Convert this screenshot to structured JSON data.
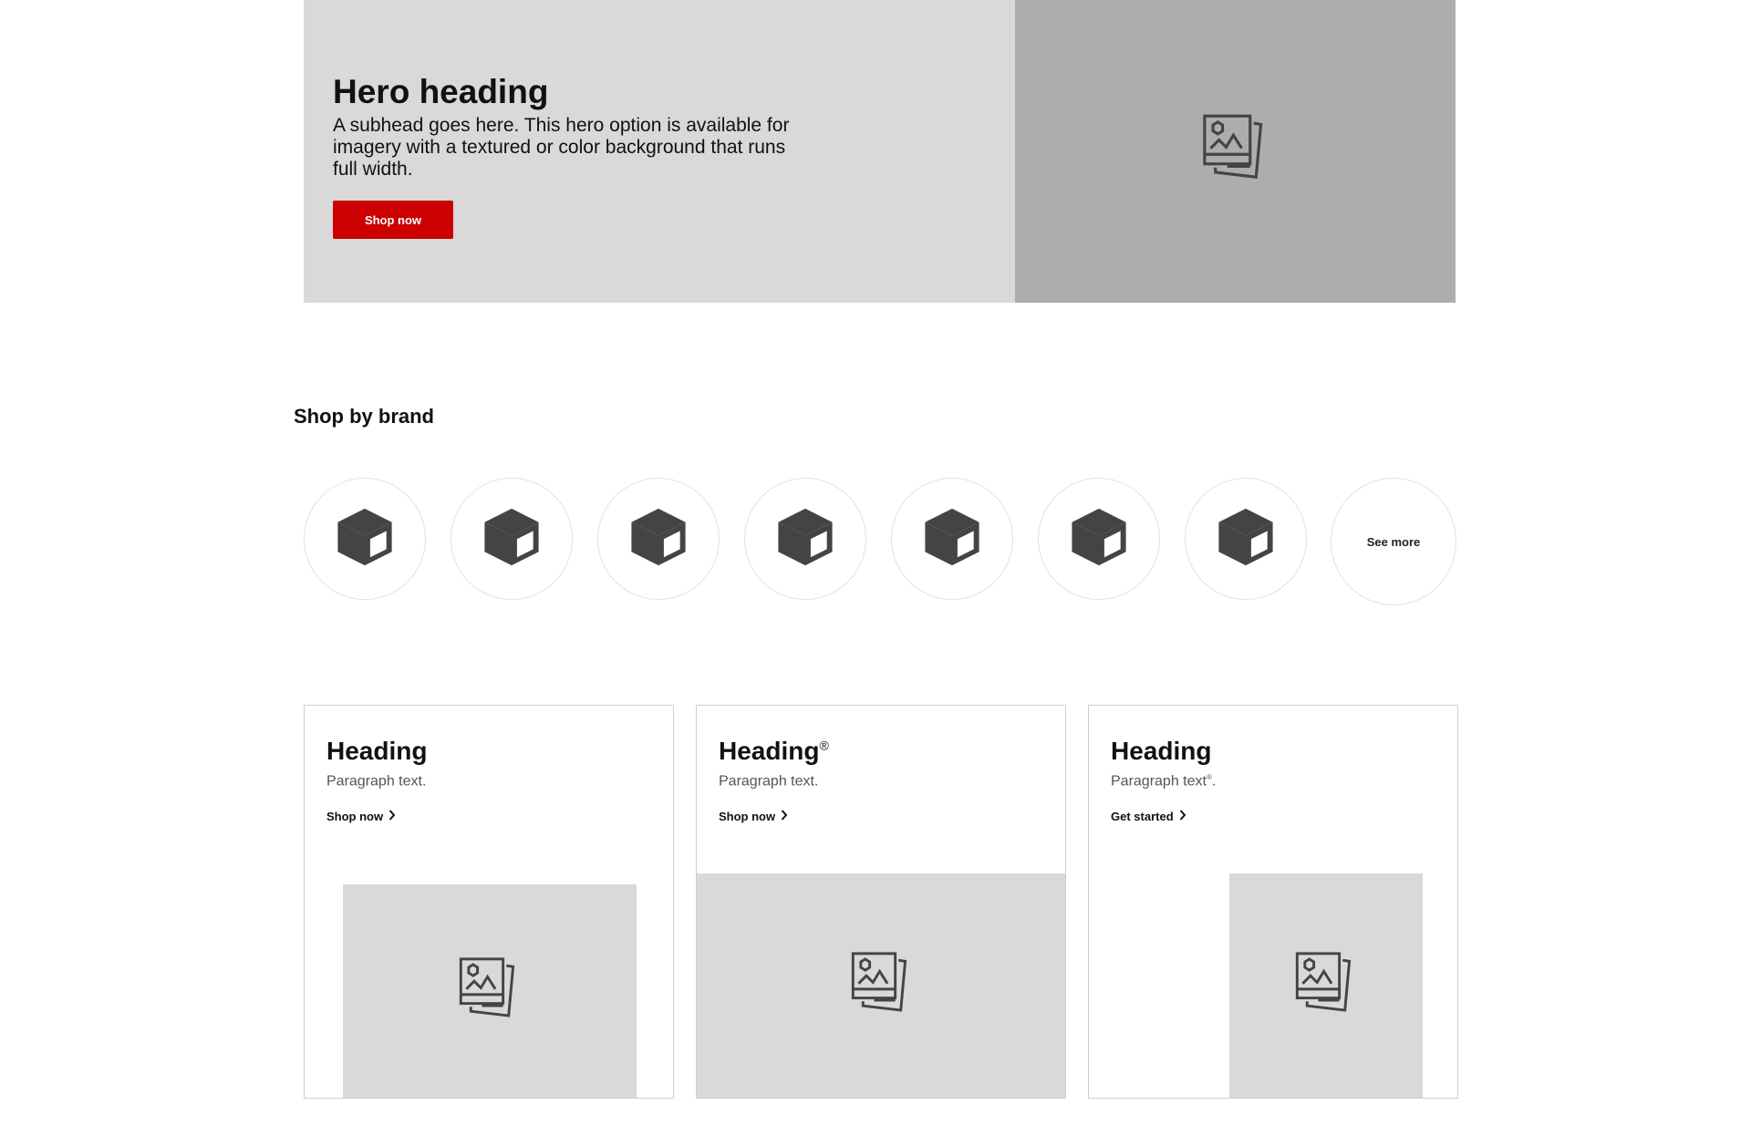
{
  "hero": {
    "heading": "Hero heading",
    "subhead": "A subhead goes here. This hero option is available for imagery with a textured or color background that runs full width.",
    "cta_label": "Shop now",
    "image_icon": "image-placeholder-icon"
  },
  "brands": {
    "title": "Shop by brand",
    "items": [
      {
        "icon": "cube-icon"
      },
      {
        "icon": "cube-icon"
      },
      {
        "icon": "cube-icon"
      },
      {
        "icon": "cube-icon"
      },
      {
        "icon": "cube-icon"
      },
      {
        "icon": "cube-icon"
      },
      {
        "icon": "cube-icon"
      }
    ],
    "see_more_label": "See more"
  },
  "cards": [
    {
      "heading": "Heading",
      "heading_mark": "",
      "text": "Paragraph text.",
      "text_mark": "",
      "text_end": "",
      "link_label": "Shop now",
      "image_icon": "image-placeholder-icon"
    },
    {
      "heading": "Heading",
      "heading_mark": "®",
      "text": "Paragraph text.",
      "text_mark": "",
      "text_end": "",
      "link_label": "Shop now",
      "image_icon": "image-placeholder-icon"
    },
    {
      "heading": "Heading",
      "heading_mark": "",
      "text": "Paragraph text",
      "text_mark": "®",
      "text_end": ".",
      "link_label": "Get started",
      "image_icon": "image-placeholder-icon"
    }
  ],
  "colors": {
    "accent": "#cc0000",
    "hero_bg": "#d9d9d9",
    "hero_image_bg": "#adadad",
    "placeholder_bg": "#d9d9d9",
    "icon": "#444444"
  }
}
